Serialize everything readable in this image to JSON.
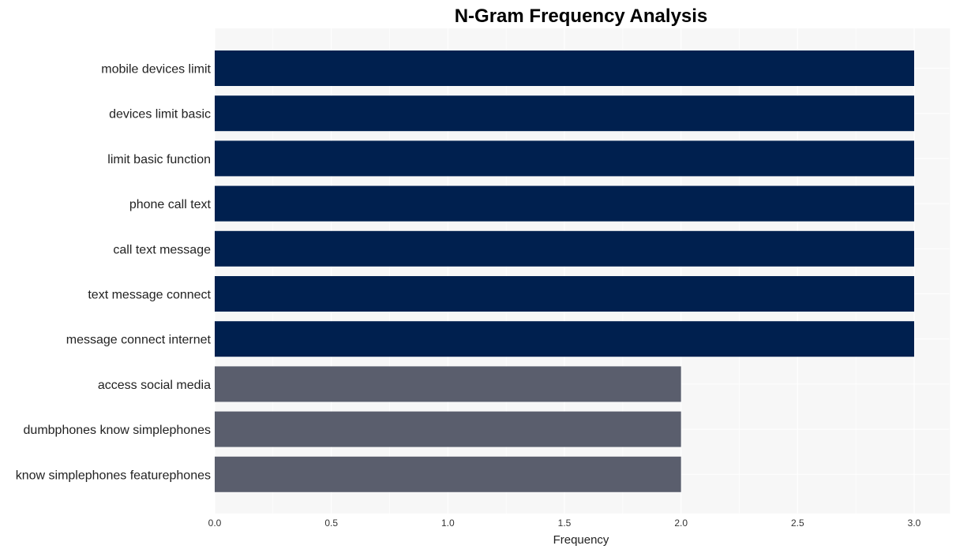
{
  "chart_data": {
    "type": "bar",
    "orientation": "horizontal",
    "title": "N-Gram Frequency Analysis",
    "xlabel": "Frequency",
    "ylabel": "",
    "xlim": [
      0,
      3.15
    ],
    "xticks": [
      0.0,
      0.5,
      1.0,
      1.5,
      2.0,
      2.5,
      3.0
    ],
    "xtick_labels": [
      "0.0",
      "0.5",
      "1.0",
      "1.5",
      "2.0",
      "2.5",
      "3.0"
    ],
    "grid": true,
    "categories": [
      "mobile devices limit",
      "devices limit basic",
      "limit basic function",
      "phone call text",
      "call text message",
      "text message connect",
      "message connect internet",
      "access social media",
      "dumbphones know simplephones",
      "know simplephones featurephones"
    ],
    "values": [
      3,
      3,
      3,
      3,
      3,
      3,
      3,
      2,
      2,
      2
    ],
    "colors": {
      "high": "#00204f",
      "low": "#5a5e6d",
      "panel_bg": "#f7f7f7",
      "grid": "#ffffff"
    }
  }
}
